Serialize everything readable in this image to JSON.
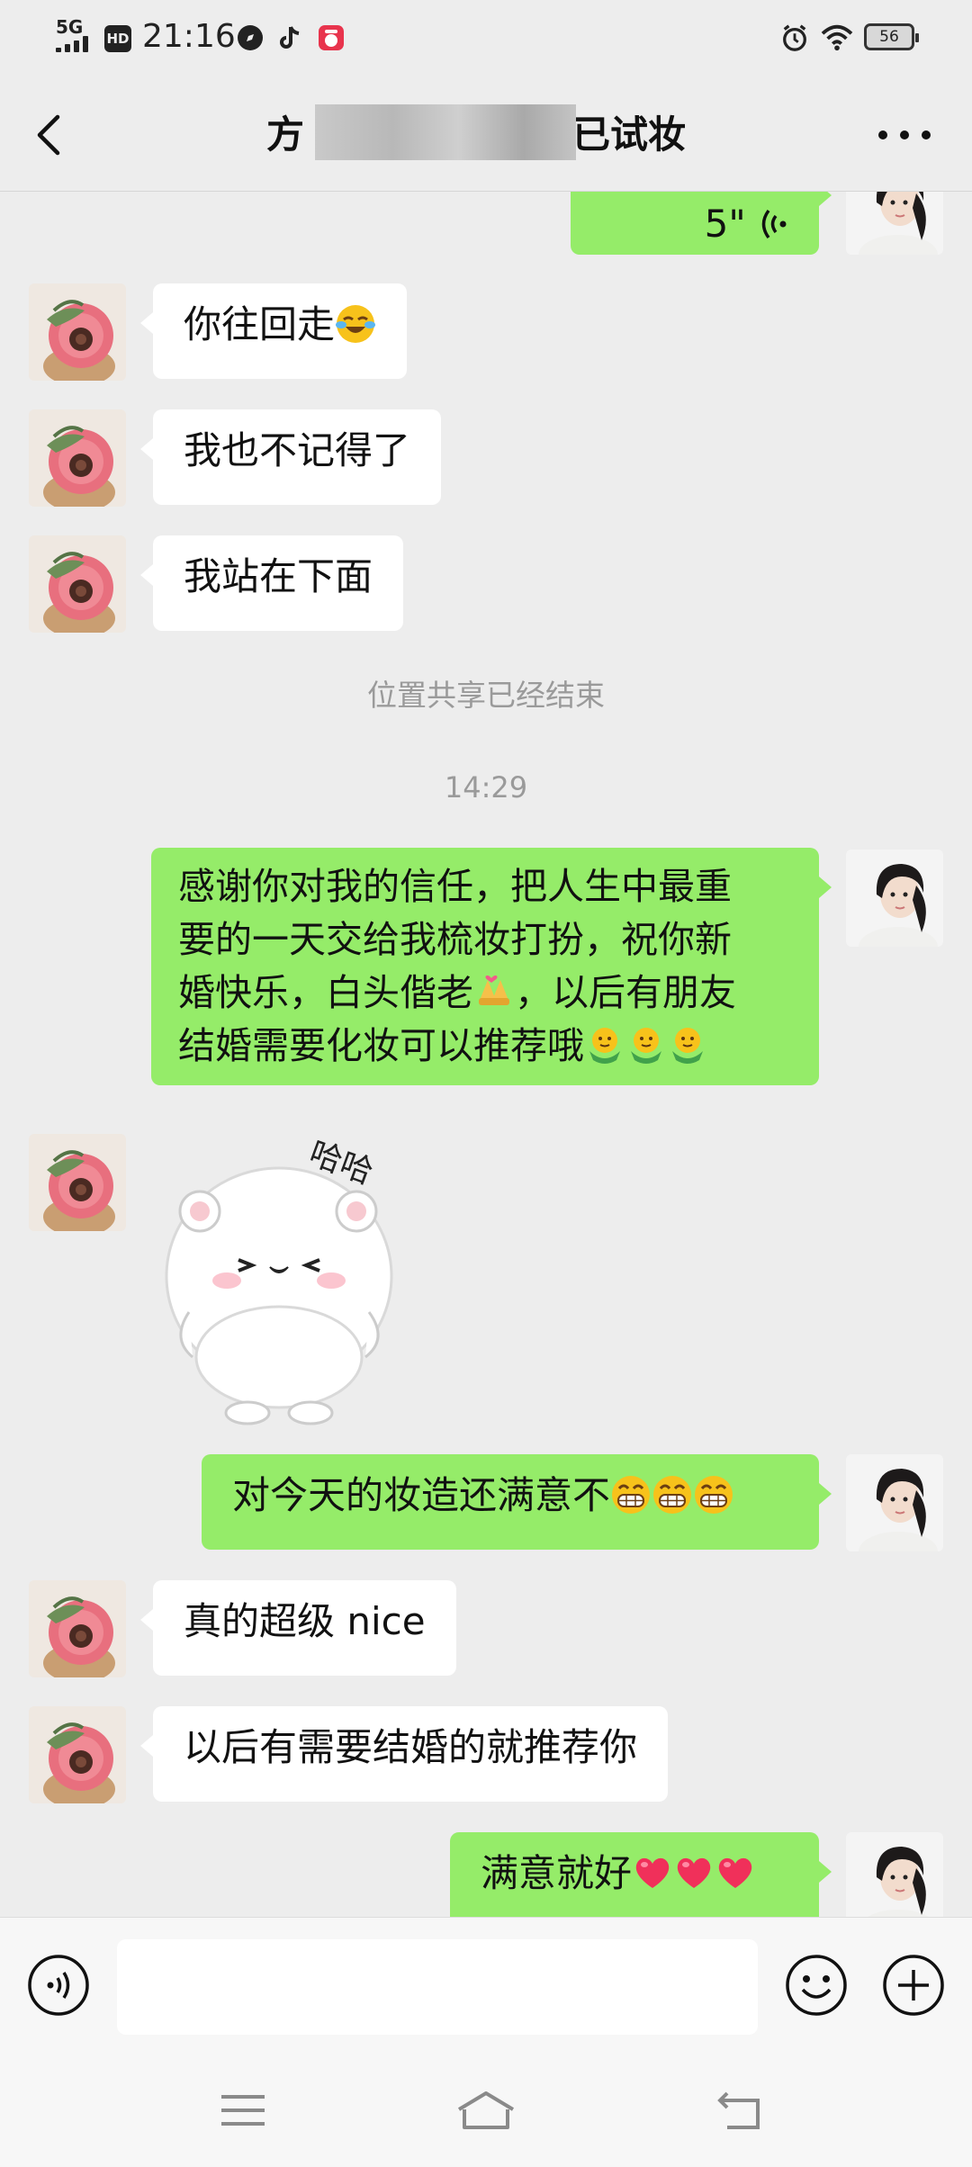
{
  "status_bar": {
    "network": "5G",
    "hd_label": "HD",
    "time": "21:16",
    "battery": "56"
  },
  "header": {
    "title_left": "方",
    "title_right": "已试妆",
    "back_icon": "chevron-left-icon",
    "more_icon": "more-horizontal-icon"
  },
  "messages": [
    {
      "side": "right",
      "type": "voice",
      "duration": "5\""
    },
    {
      "side": "left",
      "type": "text",
      "text": "你往回走"
    },
    {
      "side": "left",
      "type": "text",
      "text": "我也不记得了"
    },
    {
      "side": "left",
      "type": "text",
      "text": "我站在下面"
    },
    {
      "side": "system",
      "text": "位置共享已经结束"
    },
    {
      "side": "system",
      "text": "14:29"
    },
    {
      "side": "right",
      "type": "text",
      "lines": [
        "感谢你对我的信任，把人生中最重",
        "要的一天交给我梳妆打扮，祝你新",
        "婚快乐，白头偕老",
        "，以后有朋友",
        "结婚需要化妆可以推荐哦"
      ]
    },
    {
      "side": "left",
      "type": "sticker",
      "sticker_text": "哈哈"
    },
    {
      "side": "right",
      "type": "text",
      "text": "对今天的妆造还满意不"
    },
    {
      "side": "left",
      "type": "text",
      "text": "真的超级 nice"
    },
    {
      "side": "left",
      "type": "text",
      "text": "以后有需要结婚的就推荐你"
    },
    {
      "side": "right",
      "type": "text",
      "text": "满意就好"
    }
  ],
  "input_bar": {
    "voice_icon": "voice-input-icon",
    "emoji_icon": "emoji-icon",
    "plus_icon": "plus-icon"
  },
  "nav_bar": {
    "menu_icon": "menu-icon",
    "home_icon": "home-icon",
    "back_icon": "back-icon"
  },
  "colors": {
    "background": "#ededed",
    "green_bubble": "#95ec69",
    "white_bubble": "#ffffff",
    "system_text": "#9a9a9a"
  }
}
